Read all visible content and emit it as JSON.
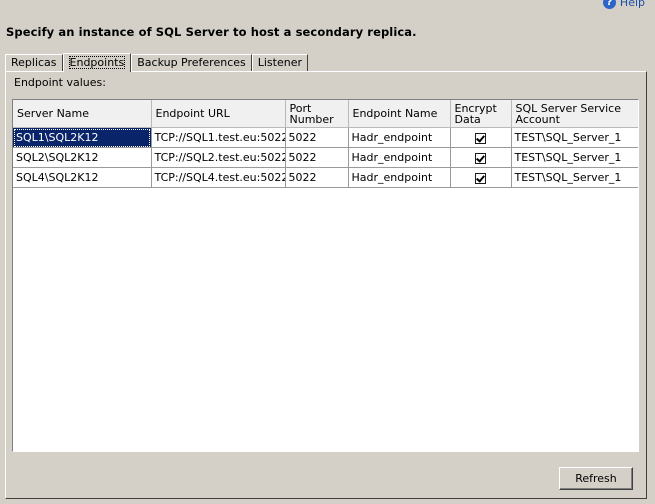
{
  "help": {
    "label": "Help",
    "icon": "help-icon"
  },
  "heading": "Specify an instance of SQL Server to host a secondary replica.",
  "tabs": [
    {
      "label": "Replicas",
      "active": false
    },
    {
      "label": "Endpoints",
      "active": true
    },
    {
      "label": "Backup Preferences",
      "active": false
    },
    {
      "label": "Listener",
      "active": false
    }
  ],
  "endpoints": {
    "label": "Endpoint values:",
    "columns": [
      "Server Name",
      "Endpoint URL",
      "Port Number",
      "Endpoint Name",
      "Encrypt Data",
      "SQL Server Service Account"
    ],
    "rows": [
      {
        "server": "SQL1\\SQL2K12",
        "url": "TCP://SQL1.test.eu:5022",
        "port": "5022",
        "name": "Hadr_endpoint",
        "encrypt": true,
        "account": "TEST\\SQL_Server_1"
      },
      {
        "server": "SQL2\\SQL2K12",
        "url": "TCP://SQL2.test.eu:5022",
        "port": "5022",
        "name": "Hadr_endpoint",
        "encrypt": true,
        "account": "TEST\\SQL_Server_1"
      },
      {
        "server": "SQL4\\SQL2K12",
        "url": "TCP://SQL4.test.eu:5022",
        "port": "5022",
        "name": "Hadr_endpoint",
        "encrypt": true,
        "account": "TEST\\SQL_Server_1"
      }
    ]
  },
  "refresh_label": "Refresh",
  "colors": {
    "selection": "#0a246a",
    "window": "#d4d0c8"
  }
}
